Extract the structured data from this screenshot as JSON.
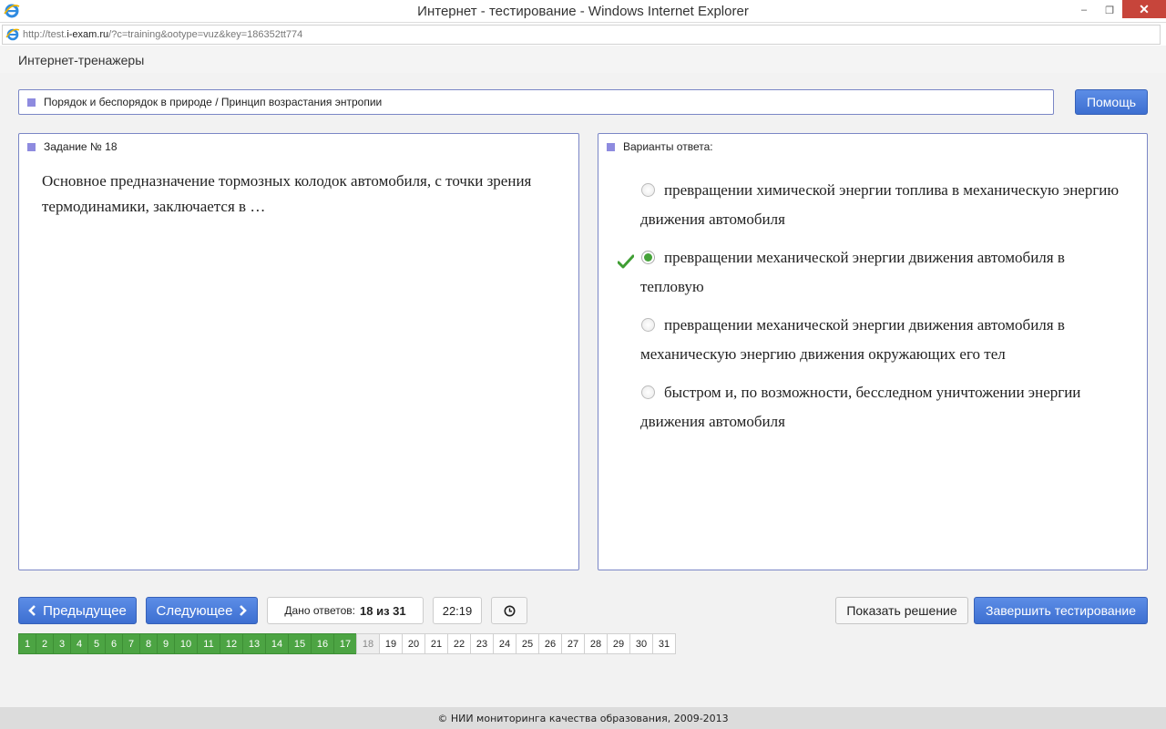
{
  "window": {
    "title": "Интернет - тестирование - Windows Internet Explorer",
    "minimize": "‒",
    "restore": "❐",
    "close": "✕"
  },
  "address": {
    "prefix": "http://test.",
    "domain": "i-exam.ru",
    "path": "/?c=training&ootype=vuz&key=186352tt774"
  },
  "header": {
    "brand": "Интернет-тренажеры"
  },
  "topic": {
    "text": "Порядок и беспорядок в природе / Принцип возрастания энтропии"
  },
  "help_button": "Помощь",
  "question": {
    "heading": "Задание № 18",
    "text": "Основное предназначение тормозных колодок автомобиля, с точки зрения термодинамики, заключается в …"
  },
  "answers": {
    "heading": "Варианты ответа:",
    "options": [
      {
        "text": "превращении химической энергии топлива в механическую энергию движения автомобиля",
        "selected": false
      },
      {
        "text": "превращении механической энергии движения автомобиля в тепловую",
        "selected": true
      },
      {
        "text": "превращении механической энергии движения автомобиля в механическую энергию движения окружающих его тел",
        "selected": false
      },
      {
        "text": "быстром и, по возможности, бесследном уничтожении энергии движения автомобиля",
        "selected": false
      }
    ]
  },
  "controls": {
    "prev_label": "Предыдущее",
    "next_label": "Следующее",
    "answers_label": "Дано ответов:",
    "answers_value": "18 из 31",
    "timer": "22:19",
    "show_solution": "Показать решение",
    "finish": "Завершить тестирование"
  },
  "pager": {
    "pages": [
      "1",
      "2",
      "3",
      "4",
      "5",
      "6",
      "7",
      "8",
      "9",
      "10",
      "11",
      "12",
      "13",
      "14",
      "15",
      "16",
      "17",
      "18",
      "19",
      "20",
      "21",
      "22",
      "23",
      "24",
      "25",
      "26",
      "27",
      "28",
      "29",
      "30",
      "31"
    ],
    "answered_count": 17,
    "current": "18"
  },
  "footer": {
    "text": "© НИИ мониторинга качества образования, 2009-2013"
  },
  "colors": {
    "accent_blue": "#3d6fd1",
    "answered_green": "#4ca443",
    "panel_border": "#7a86c6",
    "square_marker": "#8e8bdf"
  }
}
